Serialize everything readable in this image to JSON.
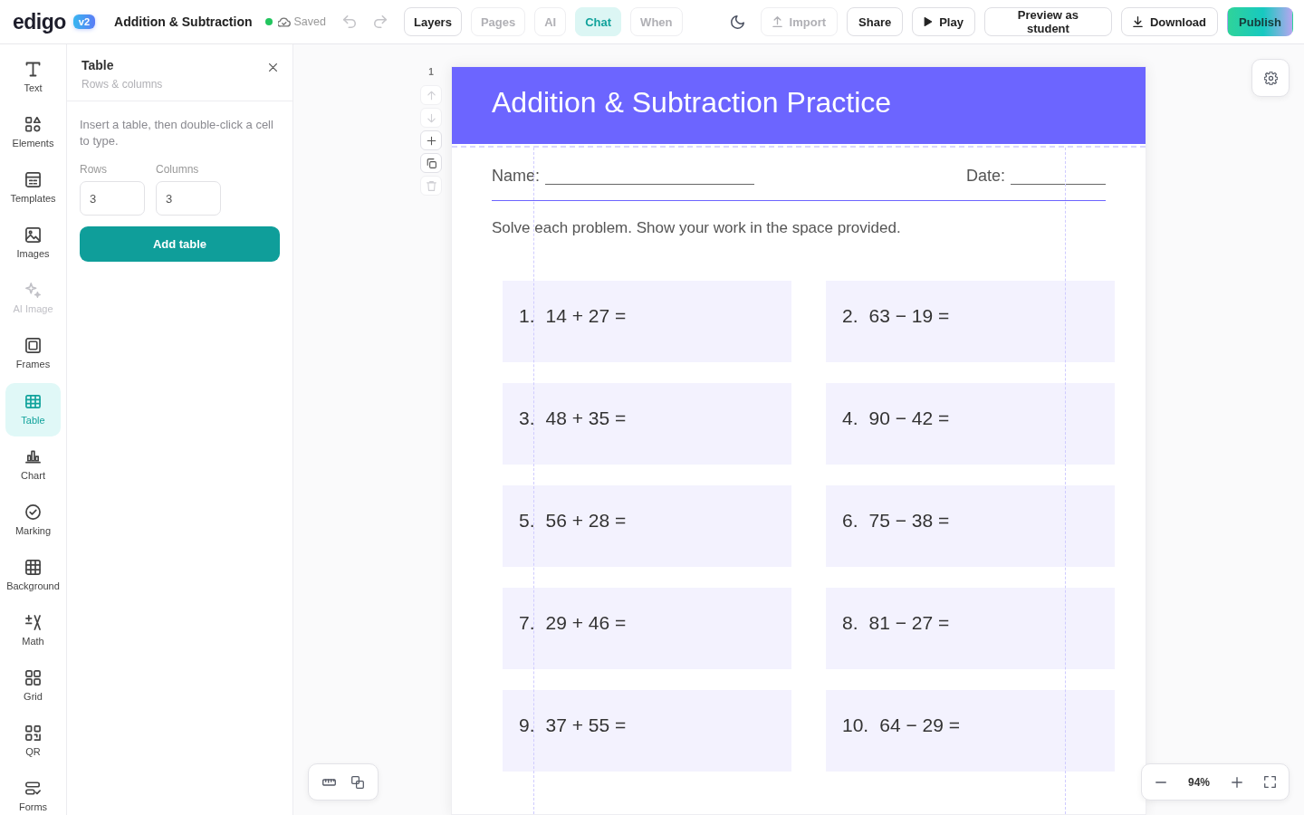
{
  "app": {
    "logo": "edigo",
    "version": "v2",
    "doc_title": "Addition & Subtraction",
    "save_status": "Saved"
  },
  "history": [
    {
      "kind": "undo",
      "disabled": true
    },
    {
      "kind": "redo",
      "disabled": true
    }
  ],
  "view_tabs": [
    {
      "label": "Layers",
      "selected": false,
      "disabled": false
    },
    {
      "label": "Pages",
      "selected": false,
      "disabled": true
    },
    {
      "label": "AI",
      "selected": false,
      "disabled": true
    },
    {
      "label": "Chat",
      "selected": true,
      "disabled": false
    },
    {
      "label": "When",
      "selected": false,
      "disabled": true
    }
  ],
  "actions": [
    {
      "label": "Import",
      "kind": "import",
      "disabled": true
    },
    {
      "label": "Share",
      "kind": "share",
      "disabled": false
    },
    {
      "label": "Play",
      "kind": "play",
      "disabled": false
    },
    {
      "label": "Preview as student",
      "kind": "preview",
      "disabled": false
    },
    {
      "label": "Download",
      "kind": "download",
      "disabled": false
    },
    {
      "label": "Publish",
      "kind": "publish",
      "disabled": false
    }
  ],
  "tool_rail": [
    {
      "label": "Text",
      "kind": "text",
      "selected": false,
      "disabled": false
    },
    {
      "label": "Elements",
      "kind": "elements",
      "selected": false,
      "disabled": false
    },
    {
      "label": "Templates",
      "kind": "templates",
      "selected": false,
      "disabled": false
    },
    {
      "label": "Images",
      "kind": "images",
      "selected": false,
      "disabled": false
    },
    {
      "label": "AI Image",
      "kind": "ai-image",
      "selected": false,
      "disabled": true
    },
    {
      "label": "Frames",
      "kind": "frames",
      "selected": false,
      "disabled": false
    },
    {
      "label": "Table",
      "kind": "table",
      "selected": true,
      "disabled": false
    },
    {
      "label": "Chart",
      "kind": "chart",
      "selected": false,
      "disabled": false
    },
    {
      "label": "Marking",
      "kind": "marking",
      "selected": false,
      "disabled": false
    },
    {
      "label": "Background",
      "kind": "background",
      "selected": false,
      "disabled": false
    },
    {
      "label": "Math",
      "kind": "math",
      "selected": false,
      "disabled": false
    },
    {
      "label": "Grid",
      "kind": "grid",
      "selected": false,
      "disabled": false
    },
    {
      "label": "QR",
      "kind": "qr",
      "selected": false,
      "disabled": false
    },
    {
      "label": "Forms",
      "kind": "forms",
      "selected": false,
      "disabled": false
    }
  ],
  "panel": {
    "title": "Table",
    "subtitle": "Rows & columns",
    "hint": "Insert a table, then double-click a cell to type.",
    "fields": [
      {
        "label": "Rows",
        "value": "3"
      },
      {
        "label": "Columns",
        "value": "3"
      }
    ],
    "button": "Add table"
  },
  "page_tools": {
    "page_number": "1",
    "buttons": [
      {
        "kind": "up",
        "disabled": true
      },
      {
        "kind": "down",
        "disabled": true
      },
      {
        "kind": "add",
        "disabled": false
      },
      {
        "kind": "duplicate",
        "disabled": false
      },
      {
        "kind": "delete",
        "disabled": true
      }
    ]
  },
  "worksheet": {
    "title": "Addition & Subtraction Practice",
    "name_label": "Name:",
    "date_label": "Date:",
    "instructions": "Solve each problem. Show your work in the space provided.",
    "problems": [
      {
        "number": "1.",
        "expression": "14 + 27 ="
      },
      {
        "number": "2.",
        "expression": "63 − 19 ="
      },
      {
        "number": "3.",
        "expression": "48 + 35 ="
      },
      {
        "number": "4.",
        "expression": "90 − 42 ="
      },
      {
        "number": "5.",
        "expression": "56 + 28 ="
      },
      {
        "number": "6.",
        "expression": "75 − 38 ="
      },
      {
        "number": "7.",
        "expression": "29 + 46 ="
      },
      {
        "number": "8.",
        "expression": "81 − 27 ="
      },
      {
        "number": "9.",
        "expression": "37 + 55 ="
      },
      {
        "number": "10.",
        "expression": "64 − 29 ="
      }
    ]
  },
  "zoom": {
    "value": "94%"
  }
}
